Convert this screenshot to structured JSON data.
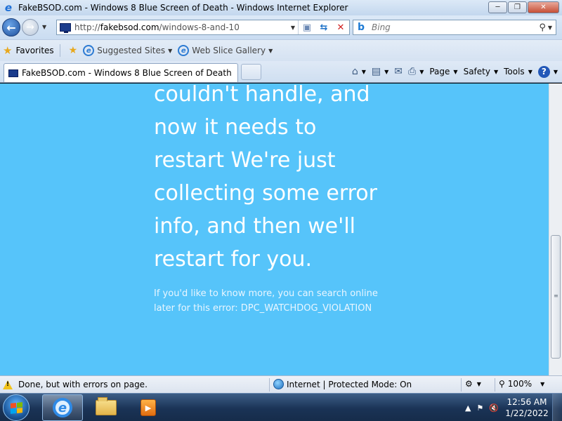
{
  "window": {
    "title": "FakeBSOD.com - Windows 8 Blue Screen of Death - Windows Internet Explorer",
    "app_icon": "ie-icon",
    "buttons": [
      "minimize",
      "maximize",
      "close"
    ]
  },
  "addressbar": {
    "url_scheme": "http://",
    "url_host": "fakebsod.com",
    "url_path": "/windows-8-and-10",
    "search_placeholder": "Bing"
  },
  "favorites_bar": {
    "favorites_label": "Favorites",
    "items": [
      {
        "label": "Suggested Sites"
      },
      {
        "label": "Web Slice Gallery"
      }
    ]
  },
  "tabs": [
    {
      "label": "FakeBSOD.com - Windows 8 Blue Screen of Death",
      "active": true
    }
  ],
  "command_bar": {
    "page_label": "Page",
    "safety_label": "Safety",
    "tools_label": "Tools"
  },
  "content": {
    "background_color": "#56c4fa",
    "main_lines": [
      "couldn't handle, and",
      "now it needs to",
      "restart We're just",
      "collecting some error",
      "info, and then we'll",
      "restart for you."
    ],
    "sub_lines": [
      "If you'd like to know more, you can search online",
      "later for this error: DPC_WATCHDOG_VIOLATION"
    ]
  },
  "statusbar": {
    "status_text": "Done, but with errors on page.",
    "zone_text": "Internet | Protected Mode: On",
    "zoom": "100%"
  },
  "taskbar": {
    "pinned": [
      "internet-explorer",
      "windows-explorer",
      "media-player"
    ],
    "active": "internet-explorer",
    "clock_time": "12:56 AM",
    "clock_date": "1/22/2022"
  }
}
